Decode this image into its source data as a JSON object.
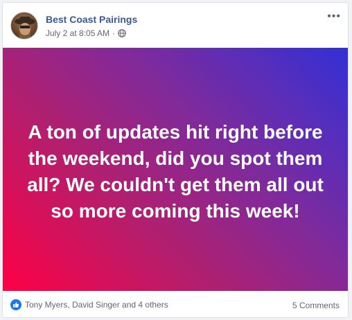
{
  "post": {
    "page_name": "Best Coast Pairings",
    "timestamp": "July 2 at 8:05 AM",
    "separator": "·",
    "privacy_icon": "globe-icon",
    "more_icon": "more-options-icon",
    "body_text": "A ton of updates hit right before the weekend, did you spot them all? We couldn't get them all out so more coming this week!"
  },
  "colors": {
    "name_link": "#385898",
    "meta_text": "#616770",
    "gradient_start": "#ff0044",
    "gradient_end": "#3330d6",
    "like_blue": "#1877f2"
  },
  "footer": {
    "reaction_icon": "like-icon",
    "reactions_text": "Tony Myers, David Singer and 4 others",
    "comments_text": "5 Comments"
  }
}
